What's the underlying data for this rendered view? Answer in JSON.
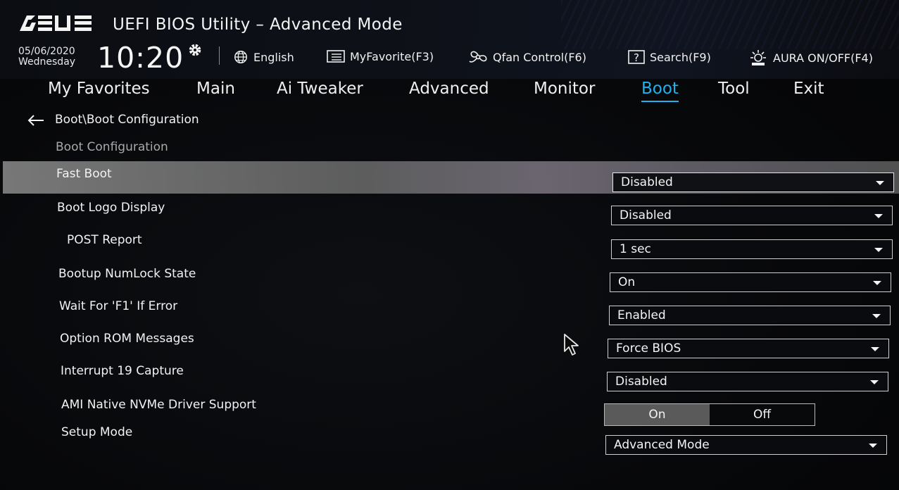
{
  "header": {
    "brand": "ASUS",
    "title": "UEFI BIOS Utility – Advanced Mode",
    "date": "05/06/2020",
    "weekday": "Wednesday",
    "time": "10:20",
    "tools": [
      {
        "label": "English",
        "icon": "globe-icon"
      },
      {
        "label": "MyFavorite(F3)",
        "icon": "favorite-list-icon"
      },
      {
        "label": "Qfan Control(F6)",
        "icon": "fan-icon"
      },
      {
        "label": "Search(F9)",
        "icon": "search-help-icon"
      },
      {
        "label": "AURA ON/OFF(F4)",
        "icon": "aura-light-icon"
      }
    ]
  },
  "tabs": [
    {
      "label": "My Favorites",
      "active": false
    },
    {
      "label": "Main",
      "active": false
    },
    {
      "label": "Ai Tweaker",
      "active": false
    },
    {
      "label": "Advanced",
      "active": false
    },
    {
      "label": "Monitor",
      "active": false
    },
    {
      "label": "Boot",
      "active": true
    },
    {
      "label": "Tool",
      "active": false
    },
    {
      "label": "Exit",
      "active": false
    }
  ],
  "breadcrumb": "Boot\\Boot Configuration",
  "section_title": "Boot Configuration",
  "settings": [
    {
      "label": "Fast Boot",
      "value": "Disabled",
      "type": "dropdown"
    },
    {
      "label": "Boot Logo Display",
      "value": "Disabled",
      "type": "dropdown"
    },
    {
      "label": "POST Report",
      "value": "1 sec",
      "type": "dropdown"
    },
    {
      "label": "Bootup NumLock State",
      "value": "On",
      "type": "dropdown"
    },
    {
      "label": "Wait For 'F1' If Error",
      "value": "Enabled",
      "type": "dropdown"
    },
    {
      "label": "Option ROM Messages",
      "value": "Force BIOS",
      "type": "dropdown"
    },
    {
      "label": "Interrupt 19 Capture",
      "value": "Disabled",
      "type": "dropdown"
    },
    {
      "label": "AMI Native NVMe Driver Support",
      "type": "toggle",
      "options": [
        "On",
        "Off"
      ],
      "selected": "On"
    },
    {
      "label": "Setup Mode",
      "value": "Advanced Mode",
      "type": "dropdown"
    }
  ],
  "colors": {
    "accent": "#1fb2f0",
    "background": "#060709",
    "highlight_row": "#7a7a7a",
    "toggle_selected": "#5a5a5a"
  }
}
